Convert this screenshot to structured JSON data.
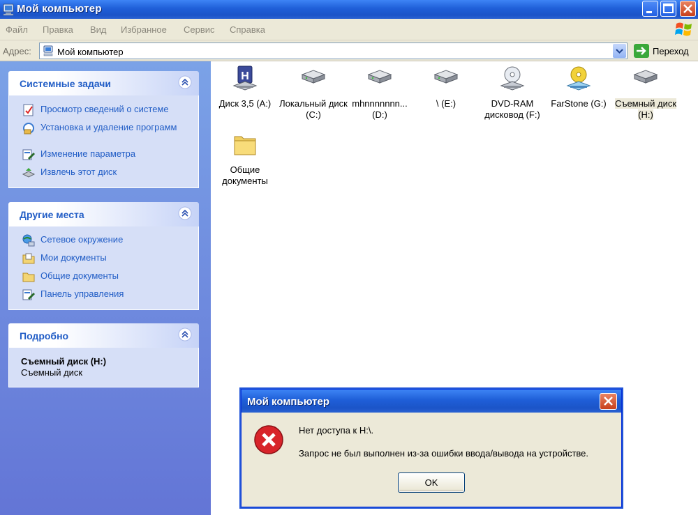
{
  "window": {
    "title": "Мой компьютер"
  },
  "menu": [
    "Файл",
    "Правка",
    "Вид",
    "Избранное",
    "Сервис",
    "Справка"
  ],
  "address": {
    "label": "Адрес:",
    "value": "Мой компьютер",
    "go_label": "Переход"
  },
  "task_pane": {
    "system_tasks": {
      "title": "Системные задачи",
      "items": [
        {
          "label": "Просмотр сведений о системе",
          "icon": "system-info-icon"
        },
        {
          "label": "Установка и удаление программ",
          "icon": "add-remove-programs-icon"
        },
        {
          "label": "Изменение параметра",
          "icon": "change-setting-icon"
        },
        {
          "label": "Извлечь этот диск",
          "icon": "eject-disk-icon"
        }
      ]
    },
    "other_places": {
      "title": "Другие места",
      "items": [
        {
          "label": "Сетевое окружение",
          "icon": "network-places-icon"
        },
        {
          "label": "Мои документы",
          "icon": "my-documents-icon"
        },
        {
          "label": "Общие документы",
          "icon": "shared-documents-icon"
        },
        {
          "label": "Панель управления",
          "icon": "control-panel-icon"
        }
      ]
    },
    "details": {
      "title": "Подробно",
      "name": "Съемный диск (H:)",
      "type": "Съемный диск"
    }
  },
  "files": [
    {
      "label": "Диск 3,5 (A:)",
      "icon": "floppy-icon"
    },
    {
      "label": "Локальный диск (C:)",
      "icon": "hard-disk-icon"
    },
    {
      "label": "mhnnnnnnn... (D:)",
      "icon": "hard-disk-icon"
    },
    {
      "label": "\\ (E:)",
      "icon": "hard-disk-icon"
    },
    {
      "label": "DVD-RAM дисковод (F:)",
      "icon": "dvd-drive-icon"
    },
    {
      "label": "FarStone (G:)",
      "icon": "cd-drive-icon"
    },
    {
      "label": "Съемный диск (H:)",
      "icon": "removable-disk-icon",
      "selected": true
    },
    {
      "label": "Общие документы",
      "icon": "folder-icon"
    }
  ],
  "dialog": {
    "title": "Мой компьютер",
    "message_line1": "Нет доступа к H:\\.",
    "message_line2": "Запрос не был выполнен из-за ошибки ввода/вывода на устройстве.",
    "ok_label": "OK"
  },
  "colors": {
    "title_bar": "#1f5fd8",
    "task_pane_bg": "#6f8ddf",
    "task_link": "#215dc6",
    "error_red": "#d8242a"
  }
}
